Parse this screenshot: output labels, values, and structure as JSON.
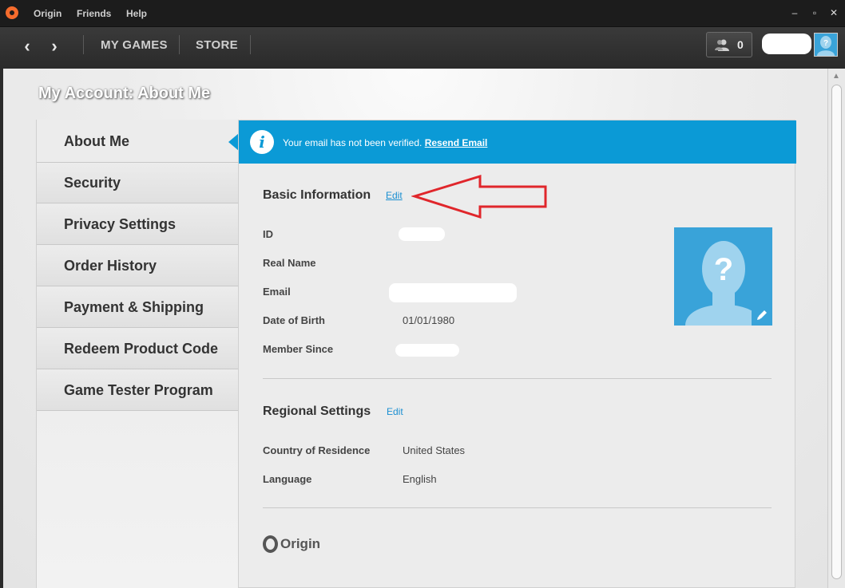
{
  "titlebar": {
    "menu": [
      "Origin",
      "Friends",
      "Help"
    ],
    "controls": {
      "minimize": "–",
      "maximize": "▫",
      "close": "✕"
    }
  },
  "navbar": {
    "back_glyph": "‹",
    "forward_glyph": "›",
    "my_games": "MY GAMES",
    "store": "STORE",
    "friends_count": "0"
  },
  "page": {
    "title": "My Account: About Me"
  },
  "sidebar": {
    "items": [
      {
        "label": "About Me",
        "active": true
      },
      {
        "label": "Security"
      },
      {
        "label": "Privacy Settings"
      },
      {
        "label": "Order History"
      },
      {
        "label": "Payment & Shipping"
      },
      {
        "label": "Redeem Product Code"
      },
      {
        "label": "Game Tester Program"
      }
    ]
  },
  "notice": {
    "icon": "info-icon",
    "text": "Your email has not been verified.",
    "link": "Resend Email"
  },
  "basic_info": {
    "title": "Basic Information",
    "edit": "Edit",
    "fields": [
      {
        "label": "ID",
        "value": ""
      },
      {
        "label": "Real Name",
        "value": ""
      },
      {
        "label": "Email",
        "value": ""
      },
      {
        "label": "Date of Birth",
        "value": "01/01/1980"
      },
      {
        "label": "Member Since",
        "value": ""
      }
    ]
  },
  "regional": {
    "title": "Regional Settings",
    "edit": "Edit",
    "fields": [
      {
        "label": "Country of Residence",
        "value": "United States"
      },
      {
        "label": "Language",
        "value": "English"
      }
    ]
  },
  "footer": {
    "logo_text": "Origin"
  },
  "colors": {
    "accent_blue": "#0b9ad6",
    "avatar_blue": "#39a3d9",
    "link_blue": "#1a8fd1",
    "annotation_red": "#e0262b",
    "origin_orange": "#f56c2d"
  }
}
